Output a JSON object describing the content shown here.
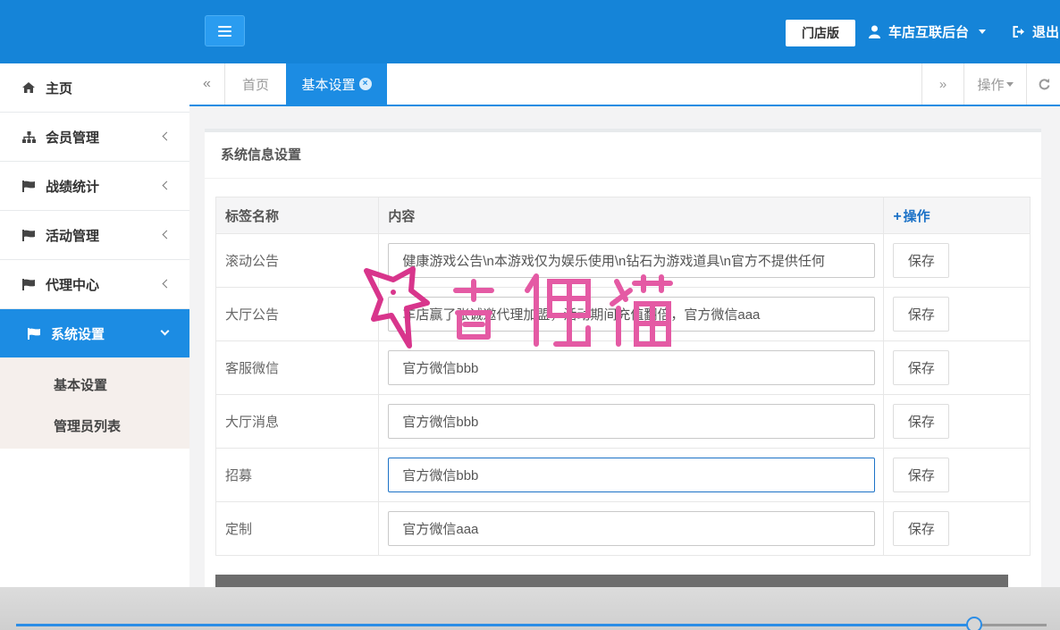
{
  "header": {
    "edition_label": "门店版",
    "user_label": "车店互联后台",
    "logout_label": "退出",
    "bg_color": "#1584d8"
  },
  "sidebar": {
    "items": [
      {
        "label": "主页",
        "icon": "home-icon"
      },
      {
        "label": "会员管理",
        "icon": "sitemap-icon"
      },
      {
        "label": "战绩统计",
        "icon": "flag-icon"
      },
      {
        "label": "活动管理",
        "icon": "flag-icon"
      },
      {
        "label": "代理中心",
        "icon": "flag-icon"
      },
      {
        "label": "系统设置",
        "icon": "flag-icon",
        "active": true
      }
    ],
    "sub_items": [
      {
        "label": "基本设置"
      },
      {
        "label": "管理员列表"
      }
    ],
    "active_color": "#1c8ce3"
  },
  "tabs": {
    "prev": "«",
    "next": "»",
    "items": [
      {
        "label": "首页"
      },
      {
        "label": "基本设置",
        "active": true
      }
    ],
    "ops_label": "操作",
    "refresh_icon": "refresh-icon"
  },
  "panel": {
    "title": "系统信息设置",
    "columns": [
      "标签名称",
      "内容",
      "操作"
    ],
    "rows": [
      {
        "label": "滚动公告",
        "value": "健康游戏公告\\n本游戏仅为娱乐使用\\n钻石为游戏道具\\n官方不提供任何",
        "button": "保存"
      },
      {
        "label": "大厅公告",
        "value": "车店赢了张诚邀代理加盟，活动期间充值翻倍，官方微信aaa",
        "button": "保存"
      },
      {
        "label": "客服微信",
        "value": "官方微信bbb",
        "button": "保存"
      },
      {
        "label": "大厅消息",
        "value": "官方微信bbb",
        "button": "保存"
      },
      {
        "label": "招募",
        "value": "官方微信bbb",
        "button": "保存",
        "focused": true
      },
      {
        "label": "定制",
        "value": "官方微信aaa",
        "button": "保存"
      }
    ]
  },
  "player": {
    "progress": 0.93
  }
}
